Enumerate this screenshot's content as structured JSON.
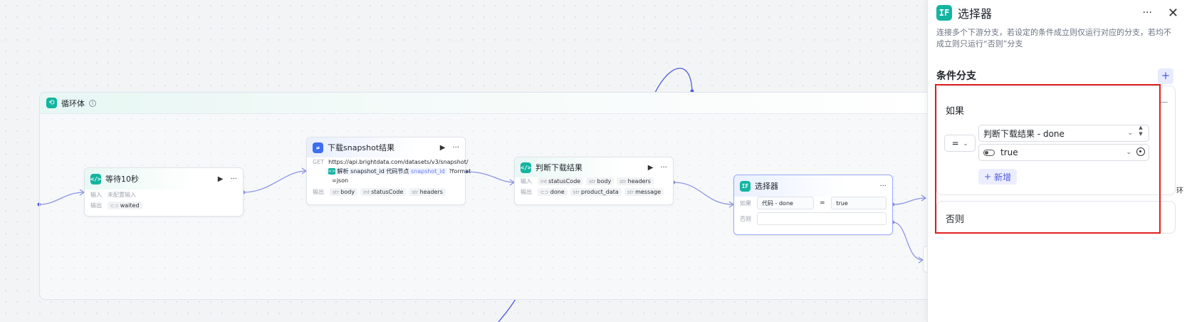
{
  "canvas": {
    "loop": {
      "title": "循环体"
    },
    "wait_node": {
      "title": "等待10秒",
      "input_label": "输入",
      "input_placeholder": "未配置输入",
      "output_label": "输出",
      "output_var": "waited"
    },
    "http_node": {
      "title": "下载snapshot结果",
      "method": "GET",
      "url_line1": "https://api.brightdata.com/datasets/v3/snapshot/",
      "chip_text": "解析 snapshot_id 代码节点",
      "chip_var": "snapshot_id",
      "url_suffix": "?format",
      "url_line3": "=json",
      "output_label": "输出",
      "outputs": [
        {
          "type": "str",
          "name": "body"
        },
        {
          "type": "int",
          "name": "statusCode"
        },
        {
          "type": "str",
          "name": "headers"
        }
      ]
    },
    "judge_node": {
      "title": "判断下载结果",
      "input_label": "输入",
      "inputs": [
        {
          "type": "int",
          "name": "statusCode"
        },
        {
          "type": "str",
          "name": "body"
        },
        {
          "type": "str",
          "name": "headers"
        }
      ],
      "output_label": "输出",
      "outputs": [
        {
          "type": "bool",
          "name": "done"
        },
        {
          "type": "str",
          "name": "product_data"
        },
        {
          "type": "str",
          "name": "message"
        }
      ]
    },
    "selector_node": {
      "title": "选择器",
      "if_label": "如果",
      "cond_left": "代码 - done",
      "cond_op": "=",
      "cond_right": "true",
      "else_label": "否则"
    }
  },
  "panel": {
    "title": "选择器",
    "icon_text": "IF",
    "description": "连接多个下游分支，若设定的条件成立则仅运行对应的分支，若均不成立则只运行“否则”分支",
    "section_title": "条件分支",
    "if_label": "如果",
    "operator": "=",
    "variable": "判断下载结果 - done",
    "value": "true",
    "add_label": "新增",
    "else_label": "否则",
    "edge_text": "环"
  }
}
